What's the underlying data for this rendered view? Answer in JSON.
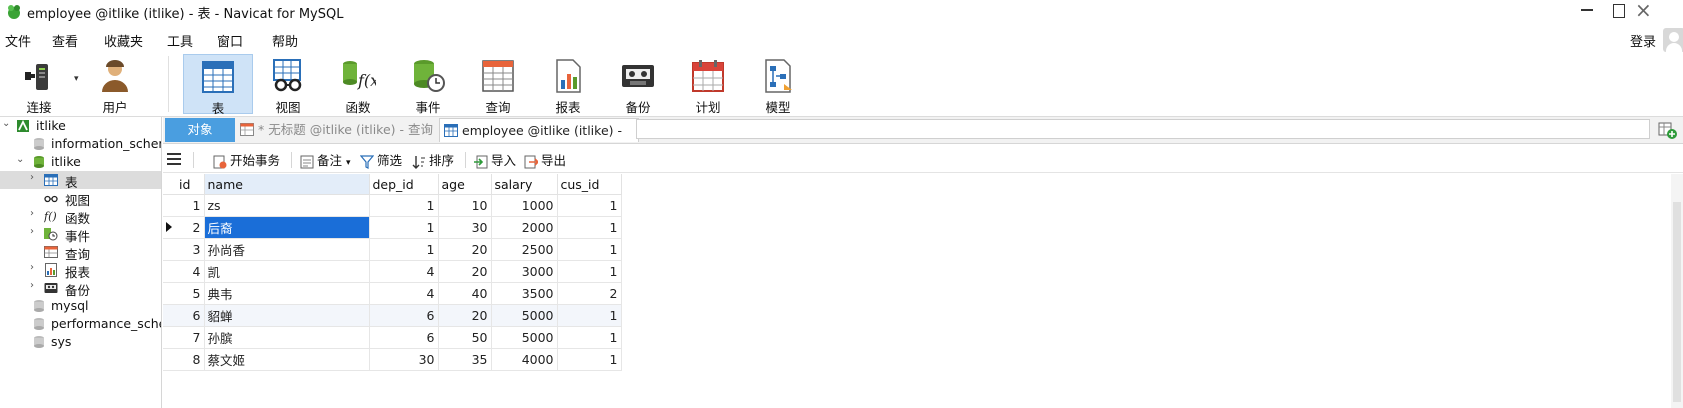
{
  "window": {
    "title": "employee @itlike (itlike) - 表 - Navicat for MySQL",
    "logo_color": "#3aa335"
  },
  "menu": [
    "文件",
    "查看",
    "收藏夹",
    "工具",
    "窗口",
    "帮助"
  ],
  "login_label": "登录",
  "toolbar": {
    "connect": "连接",
    "user": "用户",
    "table": "表",
    "view": "视图",
    "function": "函数",
    "event": "事件",
    "query": "查询",
    "report": "报表",
    "backup": "备份",
    "schedule": "计划",
    "model": "模型"
  },
  "sidebar": {
    "root": "itlike",
    "items": [
      {
        "label": "information_schem"
      },
      {
        "label": "itlike"
      },
      {
        "label": "表"
      },
      {
        "label": "视图"
      },
      {
        "label": "函数"
      },
      {
        "label": "事件"
      },
      {
        "label": "查询"
      },
      {
        "label": "报表"
      },
      {
        "label": "备份"
      },
      {
        "label": "mysql"
      },
      {
        "label": "performance_scher"
      },
      {
        "label": "sys"
      }
    ]
  },
  "tabs": {
    "objects": "对象",
    "untitled": "* 无标题 @itlike (itlike) - 查询",
    "employee": "employee @itlike (itlike) - 表"
  },
  "grid_toolbar": {
    "begin_tx": "开始事务",
    "memo": "备注",
    "filter": "筛选",
    "sort": "排序",
    "import": "导入",
    "export": "导出"
  },
  "table": {
    "columns": [
      "id",
      "name",
      "dep_id",
      "age",
      "salary",
      "cus_id"
    ],
    "rows": [
      [
        "1",
        "zs",
        "1",
        "10",
        "1000",
        "1"
      ],
      [
        "2",
        "后裔",
        "1",
        "30",
        "2000",
        "1"
      ],
      [
        "3",
        "孙尚香",
        "1",
        "20",
        "2500",
        "1"
      ],
      [
        "4",
        "凯",
        "4",
        "20",
        "3000",
        "1"
      ],
      [
        "5",
        "典韦",
        "4",
        "40",
        "3500",
        "2"
      ],
      [
        "6",
        "貂蝉",
        "6",
        "20",
        "5000",
        "1"
      ],
      [
        "7",
        "孙膑",
        "6",
        "50",
        "5000",
        "1"
      ],
      [
        "8",
        "蔡文姬",
        "30",
        "35",
        "4000",
        "1"
      ]
    ],
    "selected_row": 1,
    "selected_column": "name",
    "selected_color": "#1a6ed8"
  }
}
